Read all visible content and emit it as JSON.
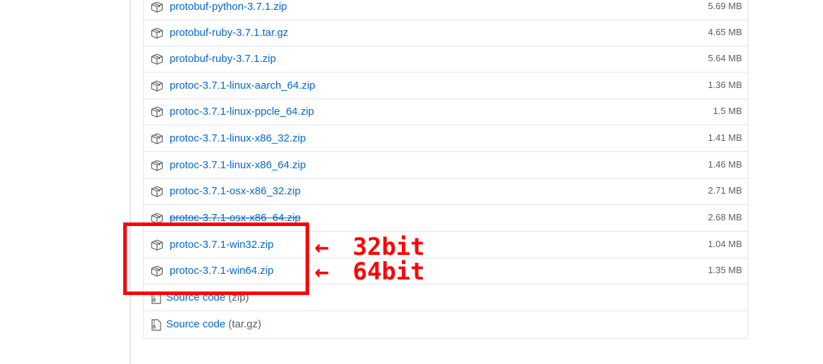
{
  "assets": [
    {
      "name": "protobuf-python-3.7.1.zip",
      "size": "5.69 MB"
    },
    {
      "name": "protobuf-ruby-3.7.1.tar.gz",
      "size": "4.65 MB"
    },
    {
      "name": "protobuf-ruby-3.7.1.zip",
      "size": "5.64 MB"
    },
    {
      "name": "protoc-3.7.1-linux-aarch_64.zip",
      "size": "1.36 MB"
    },
    {
      "name": "protoc-3.7.1-linux-ppcle_64.zip",
      "size": "1.5 MB"
    },
    {
      "name": "protoc-3.7.1-linux-x86_32.zip",
      "size": "1.41 MB"
    },
    {
      "name": "protoc-3.7.1-linux-x86_64.zip",
      "size": "1.46 MB"
    },
    {
      "name": "protoc-3.7.1-osx-x86_32.zip",
      "size": "2.71 MB"
    },
    {
      "name": "protoc-3.7.1-osx-x86_64.zip",
      "size": "2.68 MB"
    },
    {
      "name": "protoc-3.7.1-win32.zip",
      "size": "1.04 MB"
    },
    {
      "name": "protoc-3.7.1-win64.zip",
      "size": "1.35 MB"
    }
  ],
  "source_code": [
    {
      "label": "Source code",
      "ext": "(zip)"
    },
    {
      "label": "Source code",
      "ext": "(tar.gz)"
    }
  ],
  "annotations": {
    "arrow": "←",
    "win32": "32bit",
    "win64": "64bit",
    "color": "#ff0000"
  },
  "colors": {
    "link": "#0366d6",
    "muted": "#586069",
    "border": "#e1e4e8"
  },
  "icons": {
    "asset": "package-icon",
    "source": "file-zip-icon"
  }
}
